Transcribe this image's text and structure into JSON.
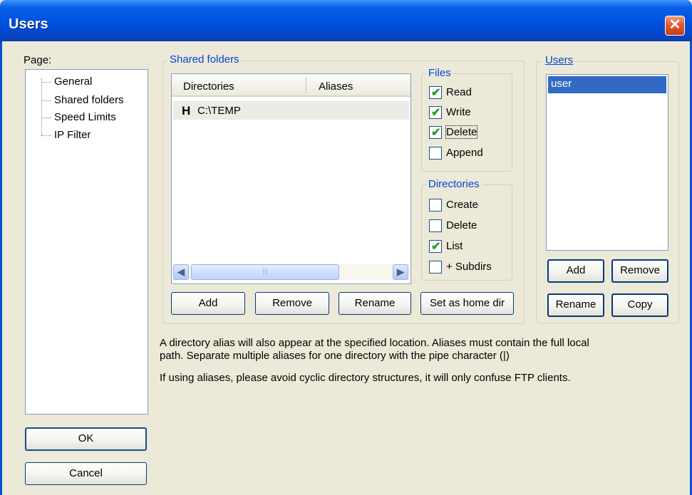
{
  "window": {
    "title": "Users",
    "close_glyph": "✕"
  },
  "page_panel": {
    "label": "Page:",
    "items": [
      "General",
      "Shared folders",
      "Speed Limits",
      "IP Filter"
    ]
  },
  "shared_folders": {
    "group_title": "Shared folders",
    "columns": [
      "Directories",
      "Aliases"
    ],
    "rows": [
      {
        "marker": "H",
        "directory": "C:\\TEMP",
        "aliases": ""
      }
    ],
    "scroll_left": "◀",
    "scroll_right": "▶",
    "scroll_grip": "|||",
    "buttons": {
      "add": "Add",
      "remove": "Remove",
      "rename": "Rename",
      "set_home": "Set as home dir"
    }
  },
  "files": {
    "title": "Files",
    "options": [
      {
        "label": "Read",
        "checked": true
      },
      {
        "label": "Write",
        "checked": true
      },
      {
        "label": "Delete",
        "checked": true
      },
      {
        "label": "Append",
        "checked": false
      }
    ]
  },
  "directories": {
    "title": "Directories",
    "options": [
      {
        "label": "Create",
        "checked": false
      },
      {
        "label": "Delete",
        "checked": false
      },
      {
        "label": "List",
        "checked": true
      },
      {
        "label": "+ Subdirs",
        "checked": false
      }
    ]
  },
  "users": {
    "title": "Users",
    "items": [
      "user"
    ],
    "buttons": {
      "add": "Add",
      "remove": "Remove",
      "rename": "Rename",
      "copy": "Copy"
    }
  },
  "info": {
    "line1": "A directory alias will also appear at the specified location. Aliases must contain the full local",
    "line2": "path. Separate multiple aliases for one directory with the pipe character (|)",
    "line3": "If using aliases, please avoid cyclic directory structures, it will only confuse FTP clients."
  },
  "footer": {
    "ok": "OK",
    "cancel": "Cancel"
  },
  "check_glyph": "✔"
}
